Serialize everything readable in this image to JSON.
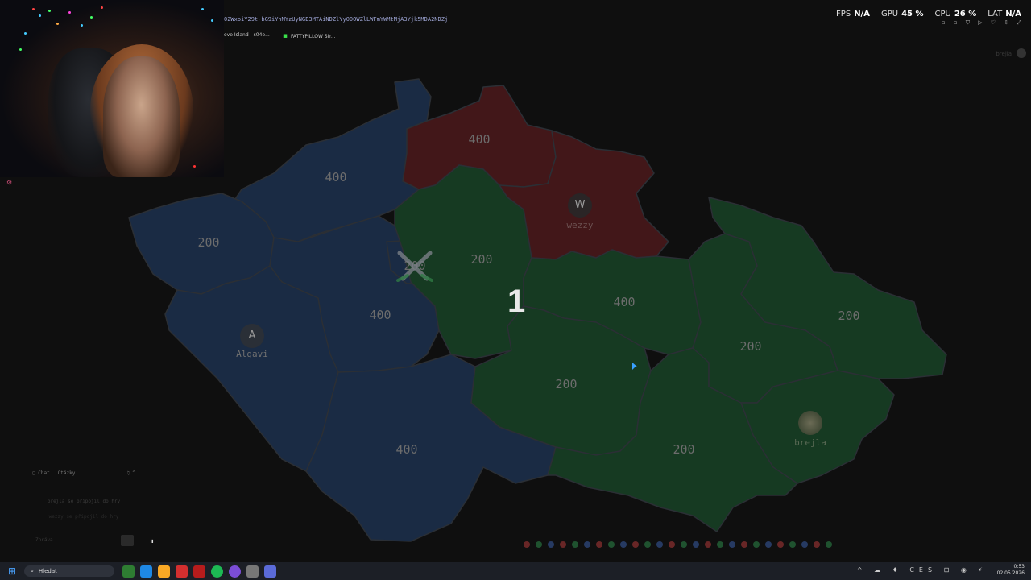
{
  "overlay": {
    "url": "0ZWxoiY29t-bG9iYnMYzUyNGE3MTAiNDZlYy00OWZlLWFmYWMtMjA3Yjk5MDA2NDZj",
    "tabs": [
      "ove Island - s04e...",
      "FATTYPILLOW Str..."
    ],
    "stats": [
      {
        "label": "FPS",
        "value": "N/A"
      },
      {
        "label": "GPU",
        "value": "45 %"
      },
      {
        "label": "CPU",
        "value": "26 %"
      },
      {
        "label": "LAT",
        "value": "N/A"
      }
    ]
  },
  "game": {
    "top_right_user": "brejla",
    "round_number": "1",
    "colors": {
      "blue": "#1a2b44",
      "red": "#421719",
      "green": "#163a22",
      "border": "#2b2f35"
    },
    "regions": [
      {
        "id": "liberecky",
        "owner": "blue",
        "value": "400"
      },
      {
        "id": "karlovarsky",
        "owner": "blue",
        "value": "200"
      },
      {
        "id": "stredocesky",
        "owner": "blue",
        "value": "400"
      },
      {
        "id": "plzensky",
        "owner": "blue",
        "value": ""
      },
      {
        "id": "jihocesky",
        "owner": "blue",
        "value": "400"
      },
      {
        "id": "ustecky",
        "owner": "red",
        "value": "400"
      },
      {
        "id": "kralovehradecky",
        "owner": "red",
        "value": ""
      },
      {
        "id": "praha",
        "owner": "green",
        "value": "200"
      },
      {
        "id": "pardubicky",
        "owner": "green",
        "value": "200"
      },
      {
        "id": "vysocina-north",
        "owner": "green",
        "value": "400"
      },
      {
        "id": "vysocina",
        "owner": "green",
        "value": "200"
      },
      {
        "id": "jihomoravsky",
        "owner": "green",
        "value": "200"
      },
      {
        "id": "olomoucky",
        "owner": "green",
        "value": "200"
      },
      {
        "id": "moravskoslezsky",
        "owner": "green",
        "value": "200"
      },
      {
        "id": "zlinsky",
        "owner": "green",
        "value": ""
      }
    ],
    "players": [
      {
        "initial": "A",
        "name": "Algavi",
        "color": "blue"
      },
      {
        "initial": "W",
        "name": "wezzy",
        "color": "red"
      },
      {
        "initial": "",
        "name": "brejla",
        "color": "green"
      }
    ]
  },
  "chat": {
    "tabs": [
      "Chat",
      "Otázky"
    ],
    "messages": [
      "brejla se připojil do hry",
      "wezzy se připojil do hry"
    ],
    "input_placeholder": "Zpráva..."
  },
  "taskbar": {
    "search_label": "Hledat",
    "language": "CES",
    "time": "0:53",
    "date": "02.05.2026"
  }
}
